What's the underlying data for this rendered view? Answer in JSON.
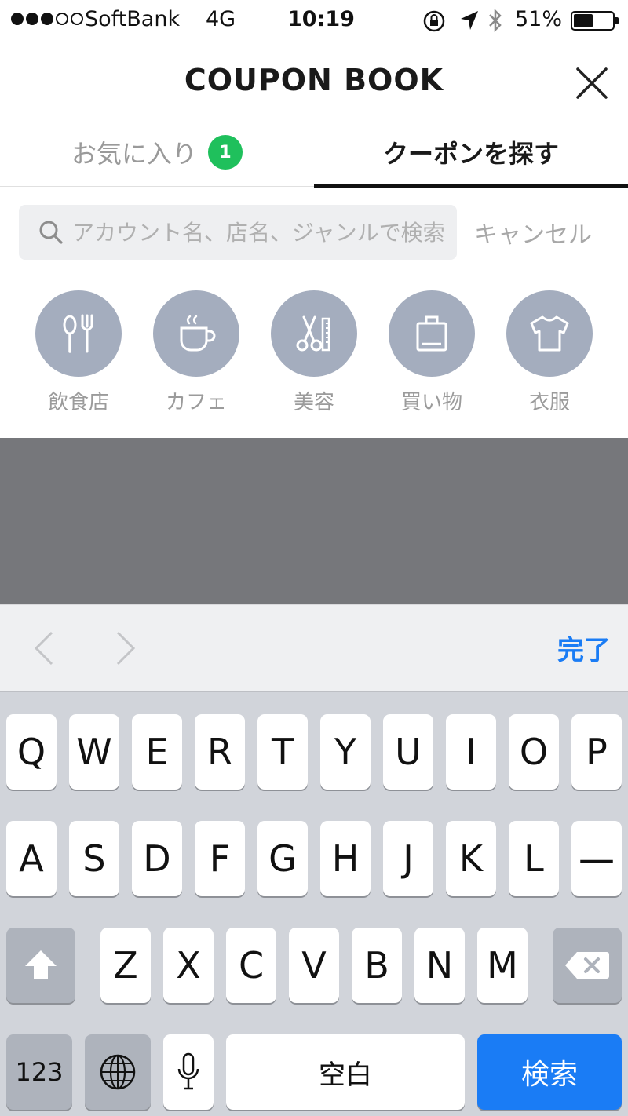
{
  "status_bar": {
    "carrier": "SoftBank",
    "network": "4G",
    "time": "10:19",
    "battery_percent": "51%",
    "battery_level": 0.51,
    "signal_bars_filled": 3,
    "signal_bars_total": 5,
    "icons": [
      "signal-dots",
      "orientation-lock-icon",
      "location-arrow-icon",
      "bluetooth-icon",
      "battery-icon"
    ]
  },
  "header": {
    "title": "COUPON BOOK",
    "close_icon": "close-icon"
  },
  "tabs": [
    {
      "label": "お気に入り",
      "badge": "1",
      "active": false
    },
    {
      "label": "クーポンを探す",
      "active": true
    }
  ],
  "search": {
    "placeholder": "アカウント名、店名、ジャンルで検索",
    "value": "",
    "cancel_label": "キャンセル",
    "icon": "search-icon"
  },
  "categories": [
    {
      "label": "飲食店",
      "icon": "restaurant-icon"
    },
    {
      "label": "カフェ",
      "icon": "cafe-icon"
    },
    {
      "label": "美容",
      "icon": "beauty-icon"
    },
    {
      "label": "買い物",
      "icon": "shopping-icon"
    },
    {
      "label": "衣服",
      "icon": "clothing-icon"
    }
  ],
  "accessory_bar": {
    "done_label": "完了",
    "prev_icon": "chevron-left-icon",
    "next_icon": "chevron-right-icon"
  },
  "keyboard": {
    "row1": [
      "Q",
      "W",
      "E",
      "R",
      "T",
      "Y",
      "U",
      "I",
      "O",
      "P"
    ],
    "row2": [
      "A",
      "S",
      "D",
      "F",
      "G",
      "H",
      "J",
      "K",
      "L",
      "—"
    ],
    "row3": [
      "Z",
      "X",
      "C",
      "V",
      "B",
      "N",
      "M"
    ],
    "numbers_label": "123",
    "space_label": "空白",
    "search_label": "検索",
    "shift_icon": "shift-icon",
    "delete_icon": "delete-icon",
    "globe_icon": "globe-icon",
    "mic_icon": "microphone-icon"
  },
  "colors": {
    "badge_green": "#1fc05c",
    "category_circle": "#a4adbe",
    "accent_blue": "#1a7cf5",
    "keyboard_bg": "#d1d4da",
    "dim_overlay": "#76777b"
  }
}
